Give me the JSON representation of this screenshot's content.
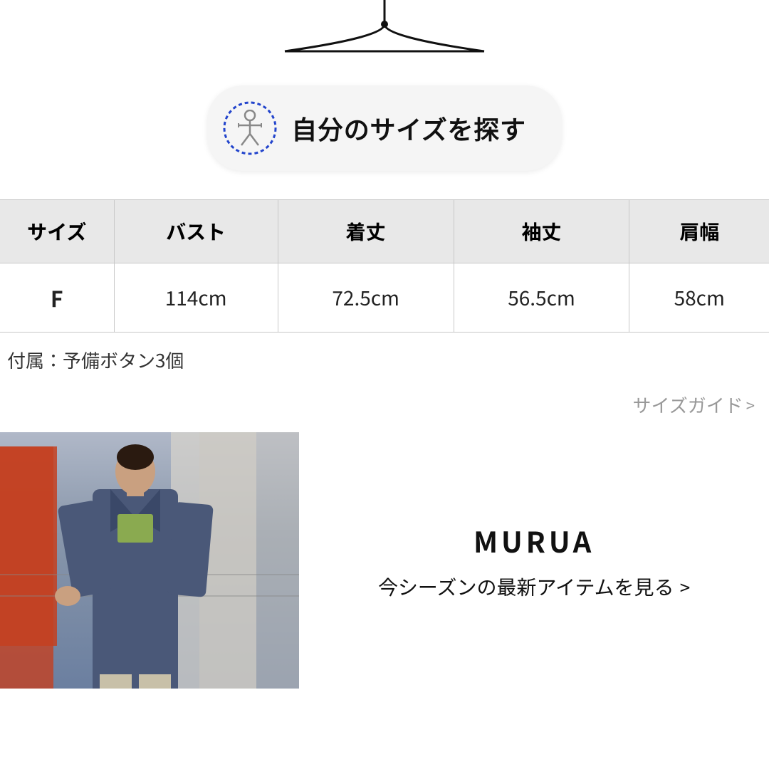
{
  "hanger": {
    "alt": "hanger graphic"
  },
  "size_finder": {
    "button_text": "自分のサイズを探す",
    "icon_alt": "body size finder icon"
  },
  "size_table": {
    "headers": [
      "サイズ",
      "バスト",
      "着丈",
      "袖丈",
      "肩幅"
    ],
    "rows": [
      [
        "F",
        "114cm",
        "72.5cm",
        "56.5cm",
        "58cm"
      ]
    ]
  },
  "accessory_note": "付属：予備ボタン3個",
  "size_guide": {
    "label": "サイズガイド",
    "chevron": ">"
  },
  "brand": {
    "name": "MURUA",
    "link_text": "今シーズンの最新アイテムを見る",
    "link_chevron": ">"
  }
}
